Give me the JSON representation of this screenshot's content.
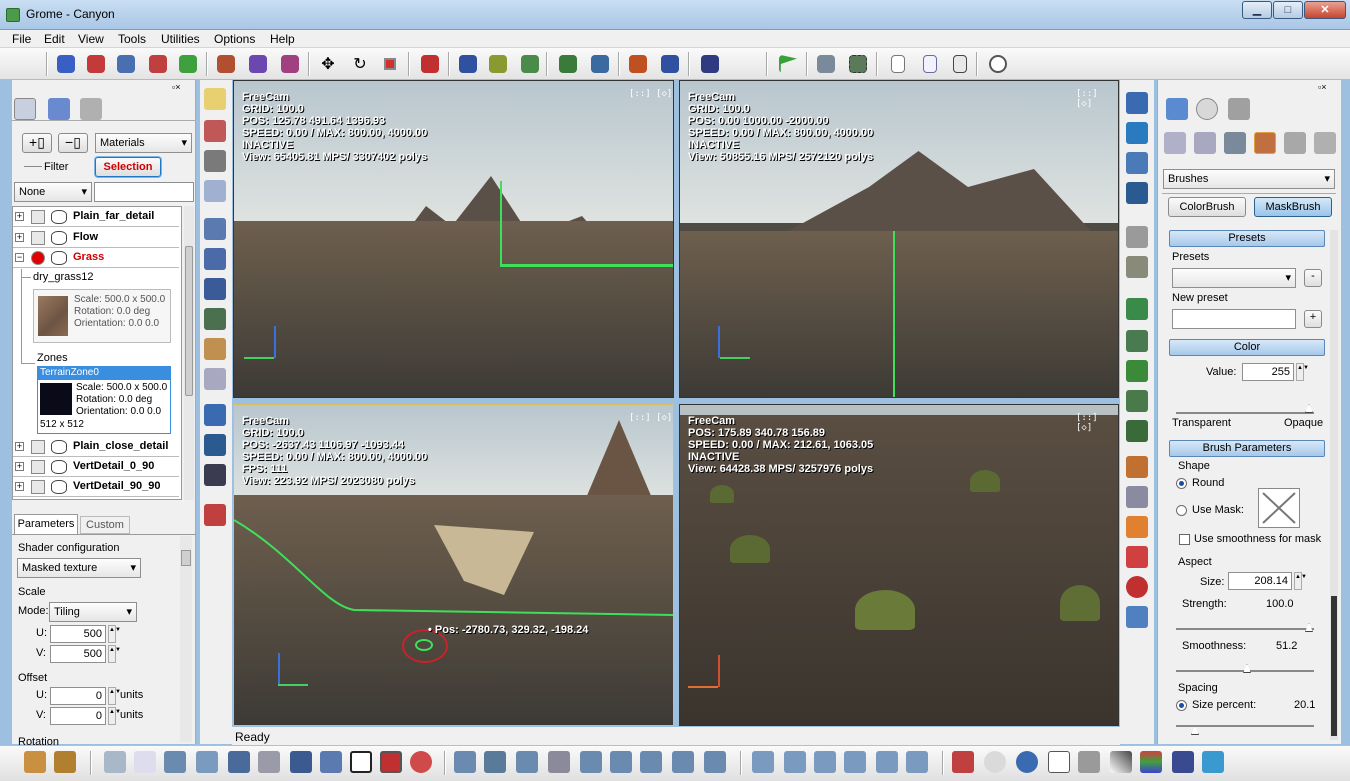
{
  "window": {
    "title": "Grome - Canyon",
    "close": "✕",
    "minimize": "▁",
    "maximize": "□"
  },
  "menu": [
    "File",
    "Edit",
    "View",
    "Tools",
    "Utilities",
    "Options",
    "Help"
  ],
  "left_panel": {
    "layer_combo": "Materials",
    "filter_label": "Filter",
    "selection_button": "Selection",
    "none_combo": "None",
    "layers": [
      {
        "name": "Plain_far_detail"
      },
      {
        "name": "Flow"
      },
      {
        "name": "Grass"
      },
      {
        "name": "Plain_close_detail"
      },
      {
        "name": "VertDetail_0_90"
      },
      {
        "name": "VertDetail_90_90"
      }
    ],
    "grass_child": "dry_grass12",
    "dry_grass_info": [
      "Scale: 500.0 x 500.0",
      "Rotation: 0.0 deg",
      "Orientation: 0.0 0.0"
    ],
    "zones_label": "Zones",
    "zone_title": "TerrainZone0",
    "zone_info": [
      "Scale: 500.0 x 500.0",
      "Rotation: 0.0 deg",
      "Orientation: 0.0 0.0"
    ],
    "zone_size": "512 x 512",
    "tabs": [
      "Parameters",
      "Custom"
    ],
    "shader_label": "Shader configuration",
    "shader_value": "Masked texture",
    "scale_label": "Scale",
    "mode_label": "Mode:",
    "mode_value": "Tiling",
    "u_label": "U:",
    "u_value": "500",
    "v_label": "V:",
    "v_value": "500",
    "offset_label": "Offset",
    "ou_label": "U:",
    "ou_value": "0",
    "ou_units": "units",
    "ov_label": "V:",
    "ov_value": "0",
    "ov_units": "units",
    "rotation_label": "Rotation"
  },
  "viewports": [
    {
      "cam": "FreeCam",
      "lines": [
        "GRID: 100.0",
        "POS: 125.78 491.64 1396.93",
        "SPEED: 0.00 / MAX: 800.00, 4000.00",
        "INACTIVE",
        "View: 65405.81 MPS/ 3307402 polys"
      ]
    },
    {
      "cam": "FreeCam",
      "lines": [
        "GRID: 100.0",
        "POS: 0.00 1000.00 -2000.00",
        "SPEED: 0.00 / MAX: 800.00, 4000.00",
        "INACTIVE",
        "View: 50855.16 MPS/ 2572120 polys"
      ]
    },
    {
      "cam": "FreeCam",
      "lines": [
        "GRID: 100.0",
        "POS: -2637.43 1106.97 -1093.44",
        "SPEED: 0.00 / MAX: 800.00, 4000.00",
        "FPS: 111",
        "View: 223.92 MPS/ 2023080 polys"
      ]
    },
    {
      "cam": "FreeCam",
      "lines": [
        "POS: 175.89 340.78 156.89",
        "SPEED: 0.00 / MAX: 212.61, 1063.05",
        "INACTIVE",
        "View: 64428.38 MPS/ 3257976 polys"
      ]
    }
  ],
  "viewport_controls": "[::] [◇]",
  "cursor_pos": "Pos: -2780.73, 329.32, -198.24",
  "status": "Ready",
  "right_panel": {
    "brushes_combo": "Brushes",
    "color_brush": "ColorBrush",
    "mask_brush": "MaskBrush",
    "presets_header": "Presets",
    "presets_label": "Presets",
    "new_preset_label": "New preset",
    "minus": "-",
    "plus": "+",
    "color_header": "Color",
    "value_label": "Value:",
    "value": "255",
    "transparent_label": "Transparent",
    "opaque_label": "Opaque",
    "brush_params_header": "Brush Parameters",
    "shape_label": "Shape",
    "round_label": "Round",
    "use_mask_label": "Use Mask:",
    "smooth_mask_label": "Use smoothness for mask",
    "aspect_label": "Aspect",
    "size_label": "Size:",
    "size_value": "208.14",
    "strength_label": "Strength:",
    "strength_value": "100.0",
    "smoothness_label": "Smoothness:",
    "smoothness_value": "51.2",
    "spacing_label": "Spacing",
    "size_percent_label": "Size percent:",
    "size_percent_value": "20.1"
  },
  "colors": {
    "accent": "#1e78c8",
    "selection_red": "#d00000",
    "terrain_green": "#3ee05a"
  }
}
